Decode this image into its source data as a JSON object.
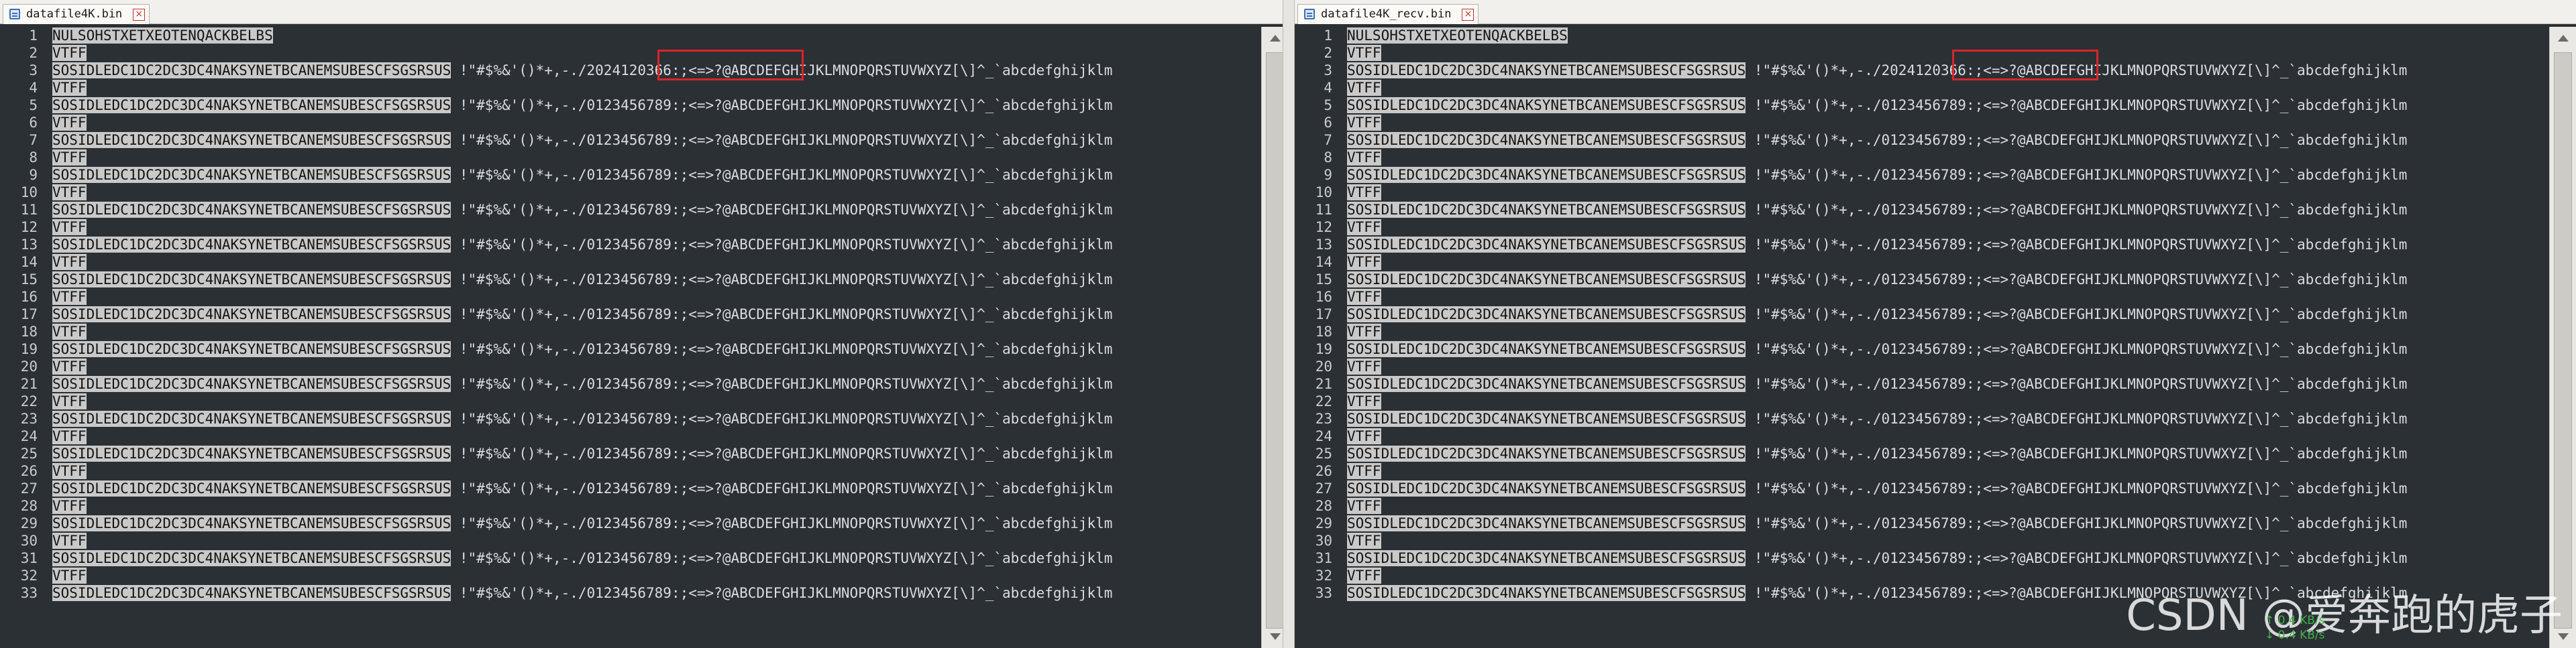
{
  "left": {
    "tab_title": "datafile4K.bin",
    "close_glyph": "×",
    "highlight_text": "./2024120366:"
  },
  "right": {
    "tab_title": "datafile4K_recv.bin",
    "close_glyph": "×",
    "highlight_text": "./2024120366:"
  },
  "content": {
    "line_numbers": [
      "1",
      "2",
      "3",
      "4",
      "5",
      "6",
      "7",
      "8",
      "9",
      "10",
      "11",
      "12",
      "13",
      "14",
      "15",
      "16",
      "17",
      "18",
      "19",
      "20",
      "21",
      "22",
      "23",
      "24",
      "25",
      "26",
      "27",
      "28",
      "29",
      "30",
      "31",
      "32",
      "33"
    ],
    "ctrl_row_1": "NULSOHSTXETXEOTENQACKBELBS",
    "ctrl_row_odd": "SOSIDLEDC1DC2DC3DC4NAKSYNETBCANEMSUBESCFSGSRSUS",
    "ctrl_row_even": "VTFF",
    "line3_tail": " !\"#$%&'()*+,-./2024120366:;<=>?@ABCDEFGHIJKLMNOPQRSTUVWXYZ[\\]^_`abcdefghijklm",
    "ascii_tail": " !\"#$%&'()*+,-./0123456789:;<=>?@ABCDEFGHIJKLMNOPQRSTUVWXYZ[\\]^_`abcdefghijklm"
  },
  "watermark": "CSDN @爱奔跑的虎子",
  "net_speed": {
    "up": "↑ 0.4 KB/s",
    "down": "↓ 0.4 KB/s"
  },
  "colors": {
    "editor_bg": "#2b3034",
    "text": "#d9dce0",
    "control_char_bg": "#c9c9c9",
    "highlight_box": "#d7262b",
    "net_speed": "#43b04b"
  }
}
